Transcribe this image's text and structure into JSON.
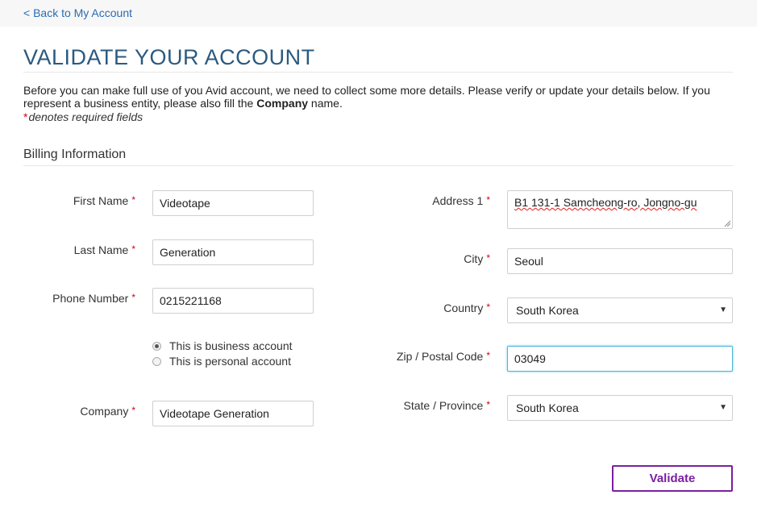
{
  "nav": {
    "back_label": "< Back to My Account"
  },
  "page": {
    "title": "VALIDATE YOUR ACCOUNT",
    "intro_part1": "Before you can make full use of you Avid account, we need to collect some more details. Please verify or update your details below. If you represent a business entity, please also fill the ",
    "intro_bold": "Company",
    "intro_part2": " name.",
    "required_star": "*",
    "required_note": "denotes required fields"
  },
  "billing": {
    "section_title": "Billing Information",
    "first_name": {
      "label": "First Name",
      "value": "Videotape"
    },
    "last_name": {
      "label": "Last Name",
      "value": "Generation"
    },
    "phone": {
      "label": "Phone Number",
      "value": "0215221168"
    },
    "account_type": {
      "business_label": "This is business account",
      "personal_label": "This is personal account",
      "selected": "business"
    },
    "company": {
      "label": "Company",
      "value": "Videotape Generation"
    },
    "address1": {
      "label": "Address 1",
      "value": "B1 131-1 Samcheong-ro, Jongno-gu"
    },
    "city": {
      "label": "City",
      "value": "Seoul"
    },
    "country": {
      "label": "Country",
      "value": "South Korea"
    },
    "zip": {
      "label": "Zip / Postal Code",
      "value": "03049"
    },
    "state": {
      "label": "State / Province",
      "value": "South Korea"
    }
  },
  "actions": {
    "validate_label": "Validate"
  },
  "colors": {
    "title": "#2b5a80",
    "link": "#2a6db3",
    "required": "#d0021b",
    "button": "#7a1fa2",
    "focus": "#4ab3e0"
  },
  "icons": {
    "dropdown": "chevron-down-icon",
    "radio": "radio-icon"
  }
}
